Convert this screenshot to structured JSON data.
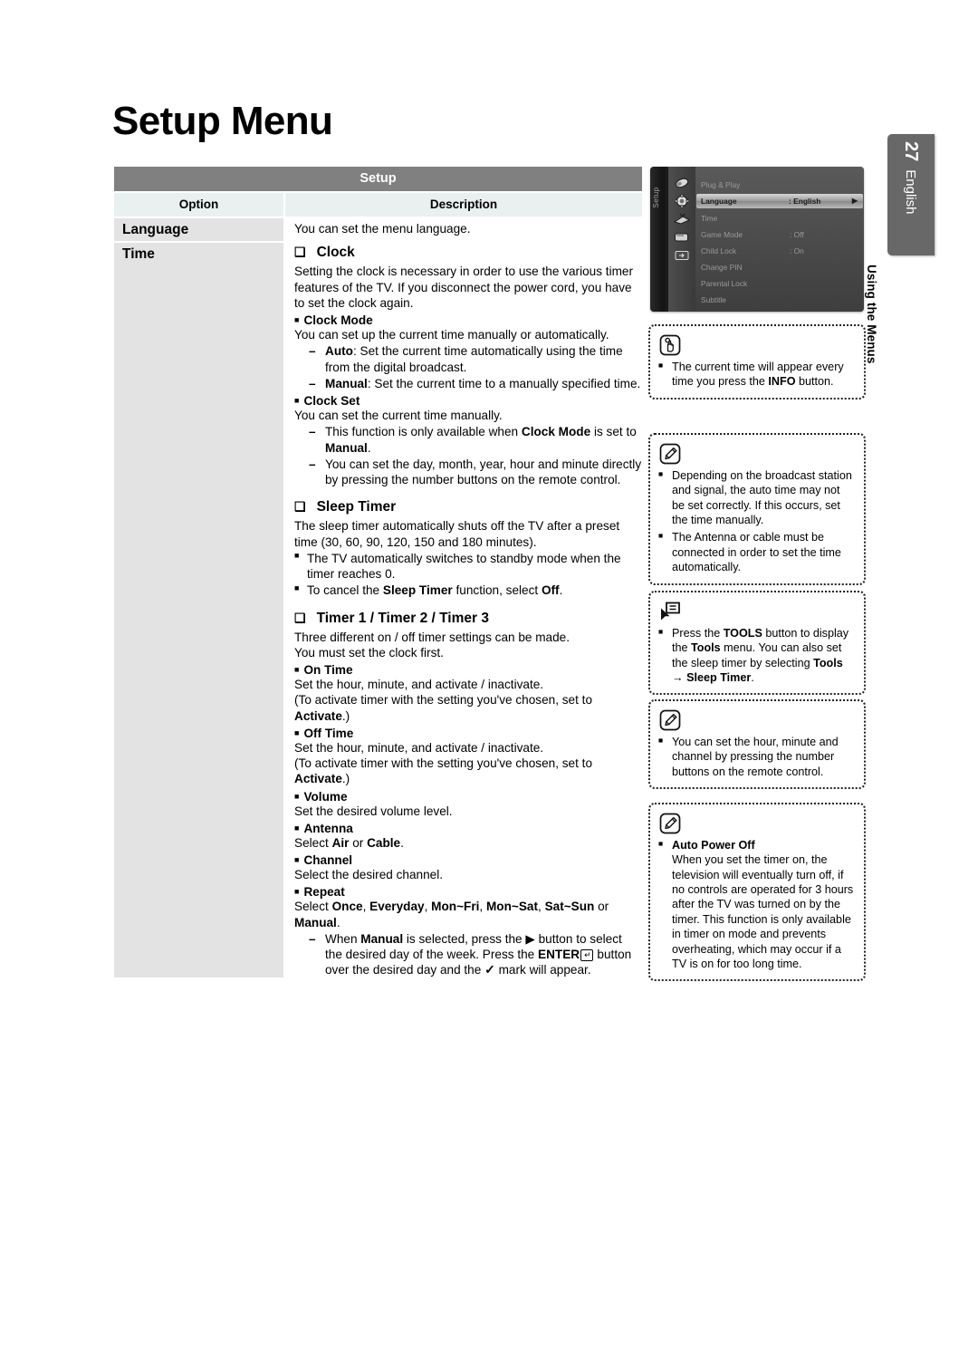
{
  "page": {
    "title": "Setup Menu",
    "number": "27",
    "language": "English",
    "section": "Using the Menus"
  },
  "table": {
    "title": "Setup",
    "col_option": "Option",
    "col_description": "Description",
    "rows": {
      "language": {
        "option": "Language",
        "description": "You can set the menu language."
      },
      "time": {
        "option": "Time"
      }
    }
  },
  "clock": {
    "heading": "Clock",
    "intro": "Setting the clock is necessary in order to use the various timer features of the TV. If you disconnect the power cord, you have to set the clock again.",
    "clock_mode": {
      "label": "Clock Mode",
      "text": "You can set up the current time manually or automatically.",
      "auto_label": "Auto",
      "auto_text": ": Set the current time automatically using the time from the digital broadcast.",
      "manual_label": "Manual",
      "manual_text": ": Set the current time to a manually specified time."
    },
    "clock_set": {
      "label": "Clock Set",
      "text": "You can set the current time manually.",
      "note1_a": "This function is only available when ",
      "note1_b": "Clock Mode",
      "note1_c": " is set to ",
      "note1_d": "Manual",
      "note1_e": ".",
      "note2": "You can set the day, month, year, hour and minute directly by pressing the number buttons on the remote control."
    }
  },
  "sleep_timer": {
    "heading": "Sleep Timer",
    "intro": "The sleep timer automatically shuts off the TV after a preset time (30, 60, 90, 120, 150 and 180 minutes).",
    "bullet1": "The TV automatically switches to standby mode when the timer reaches 0.",
    "bullet2_a": "To cancel the ",
    "bullet2_b": "Sleep Timer",
    "bullet2_c": " function, select ",
    "bullet2_d": "Off",
    "bullet2_e": "."
  },
  "timers": {
    "heading": "Timer 1 / Timer 2 / Timer 3",
    "intro1": "Three different on / off timer settings can be made.",
    "intro2": "You must set the clock first.",
    "on_time": {
      "label": "On Time",
      "text": "Set the hour, minute, and activate / inactivate.",
      "paren_a": "(To activate timer with the setting you've chosen, set to ",
      "paren_b": "Activate",
      "paren_c": ".)"
    },
    "off_time": {
      "label": "Off Time",
      "text": "Set the hour, minute, and activate / inactivate.",
      "paren_a": "(To activate timer with the setting you've chosen, set to ",
      "paren_b": "Activate",
      "paren_c": ".)"
    },
    "volume": {
      "label": "Volume",
      "text": "Set the desired volume level."
    },
    "antenna": {
      "label": "Antenna",
      "text_a": "Select ",
      "text_b": "Air",
      "text_c": " or ",
      "text_d": "Cable",
      "text_e": "."
    },
    "channel": {
      "label": "Channel",
      "text": "Select the desired channel."
    },
    "repeat": {
      "label": "Repeat",
      "text_a": "Select ",
      "opt1": "Once",
      "opt2": "Everyday",
      "opt3": "Mon~Fri",
      "opt4": "Mon~Sat",
      "opt5": "Sat~Sun",
      "text_or": " or ",
      "opt6": "Manual",
      "text_end": ".",
      "dash_a": "When ",
      "dash_b": "Manual",
      "dash_c": " is selected, press the ",
      "dash_arrow": "▶",
      "dash_d": " button to select the desired day of the week. Press the ",
      "dash_e": "ENTER",
      "dash_f": " button over the desired day and the ",
      "dash_check": "✓",
      "dash_g": " mark will appear."
    }
  },
  "osd": {
    "rail_label": "Setup",
    "items": [
      {
        "label": "Plug & Play",
        "value": ""
      },
      {
        "label": "Language",
        "value": ": English",
        "highlighted": true
      },
      {
        "label": "Time",
        "value": ""
      },
      {
        "label": "Game Mode",
        "value": ": Off"
      },
      {
        "label": "Child Lock",
        "value": ": On"
      },
      {
        "label": "Change PIN",
        "value": ""
      },
      {
        "label": "Parental Lock",
        "value": ""
      },
      {
        "label": "Subtitle",
        "value": ""
      }
    ]
  },
  "notes": {
    "note1": {
      "icon": "hand-press-icon",
      "text_a": "The current time will appear every time you press the ",
      "text_b": "INFO",
      "text_c": " button."
    },
    "note2": {
      "icon": "note-pencil-icon",
      "bullet1": "Depending on the broadcast station and signal, the auto time may not be set correctly. If this occurs, set the time manually.",
      "bullet2": "The Antenna or cable must be connected in order to set the time automatically."
    },
    "note3": {
      "icon": "tools-cursor-icon",
      "text_a": "Press the ",
      "text_b": "TOOLS",
      "text_c": " button to display the ",
      "text_d": "Tools",
      "text_e": " menu. You can also set the sleep timer by selecting ",
      "text_f": "Tools",
      "text_arrow": " → ",
      "text_g": "Sleep Timer",
      "text_h": "."
    },
    "note4": {
      "icon": "note-pencil-icon",
      "text": "You can set the hour, minute and channel by pressing the number buttons on the remote control."
    },
    "note5": {
      "icon": "note-pencil-icon",
      "title": "Auto Power Off",
      "text": "When you set the timer on, the television will eventually turn off, if no controls are operated for 3 hours after the TV was turned on by the timer. This function is only available in timer on mode and prevents overheating, which may occur if a TV is on for too long time."
    }
  },
  "colors": {
    "table_header": "#808080",
    "table_subheader": "#e9f0f0",
    "option_cell": "#e3e3e3",
    "tab": "#686868"
  }
}
